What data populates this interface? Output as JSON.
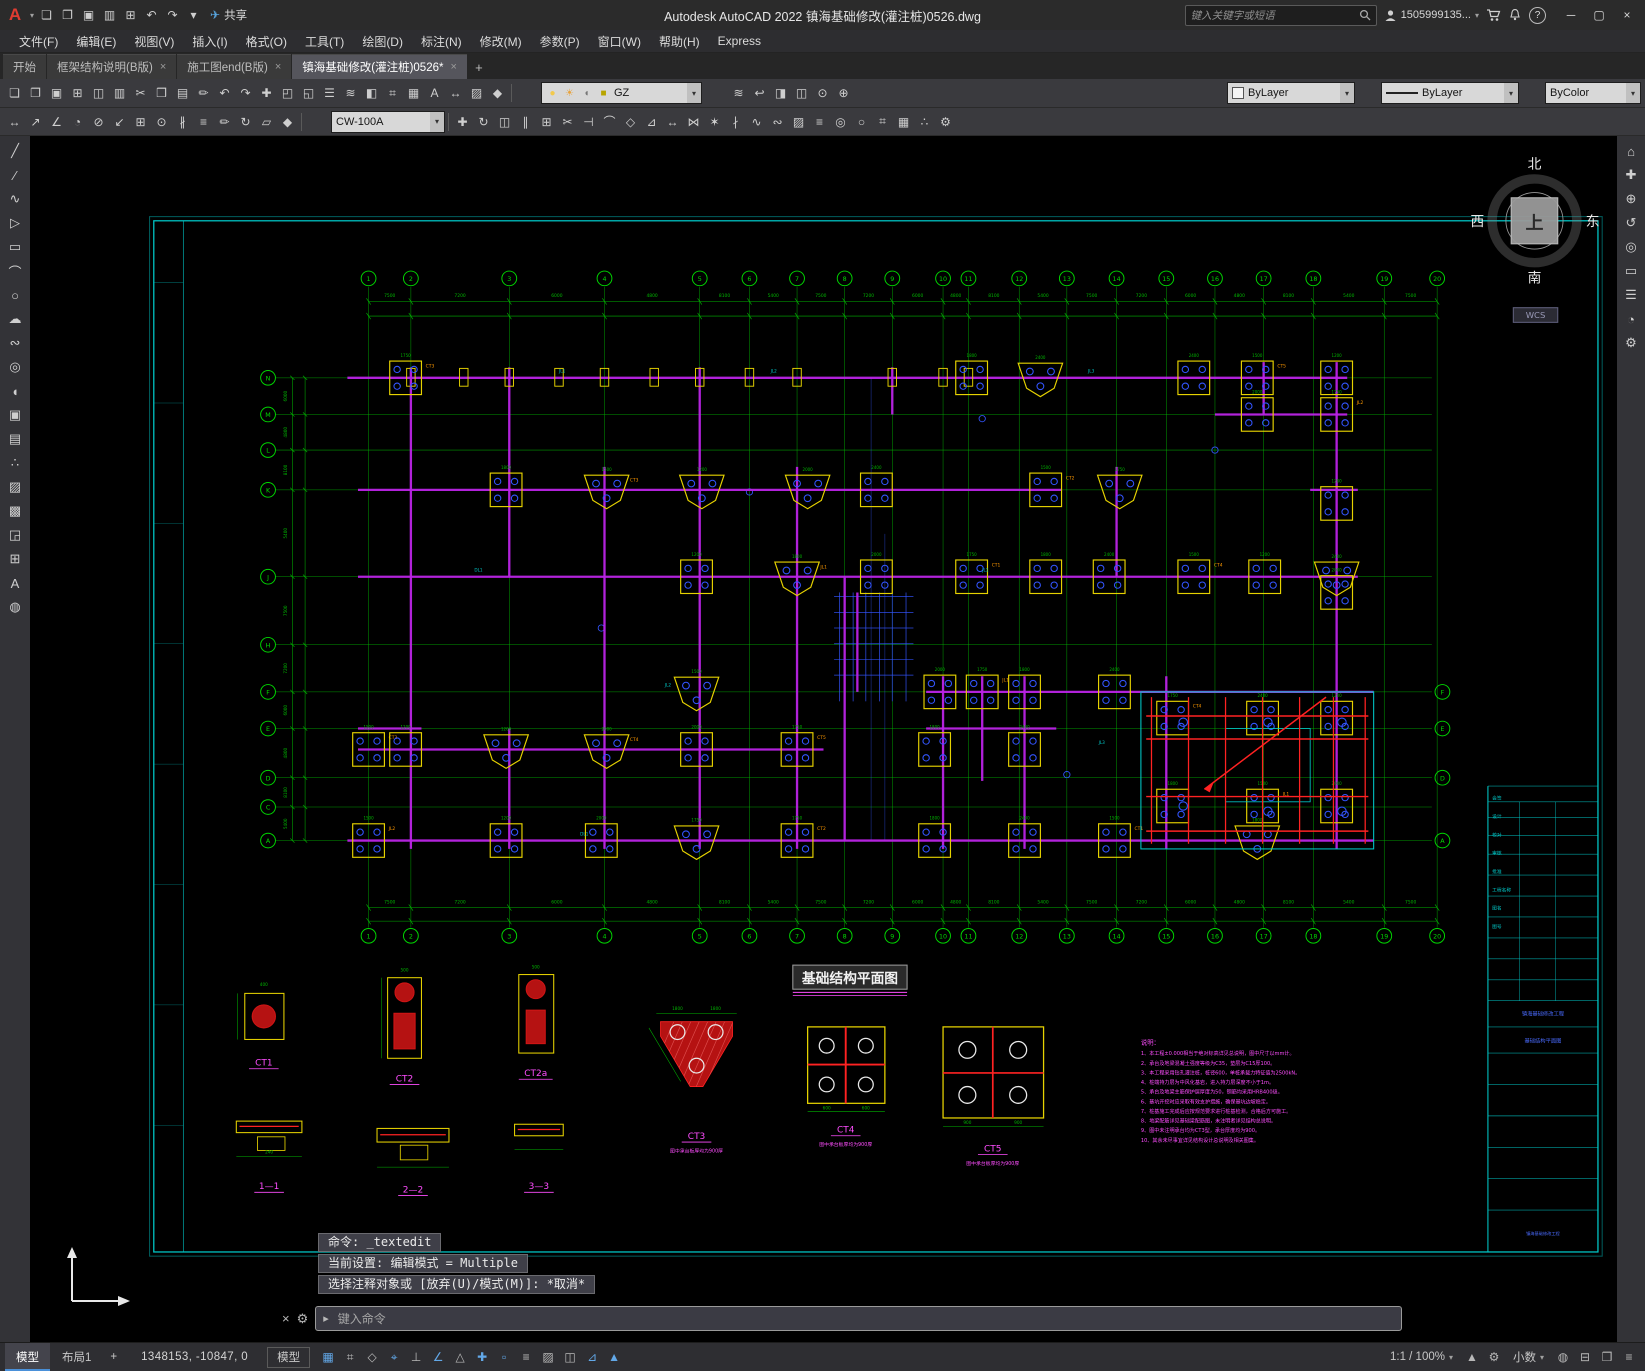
{
  "glyphs": {
    "caret": "▾",
    "close": "×"
  },
  "titlebar": {
    "logo": "A",
    "title": "Autodesk AutoCAD 2022   镇海基础修改(灌注桩)0526.dwg",
    "share_label": "共享",
    "share_icon": "✈",
    "search_placeholder": "键入关键字或短语",
    "account": "1505999135...",
    "help_glyph": "?",
    "qat_icons": [
      [
        "new-file",
        "❏"
      ],
      [
        "open-file",
        "❐"
      ],
      [
        "save",
        "▣"
      ],
      [
        "save-as",
        "▥"
      ],
      [
        "plot",
        "⊞"
      ],
      [
        "undo",
        "↶"
      ],
      [
        "redo",
        "↷"
      ],
      [
        "workspace-dropdown",
        "▾"
      ]
    ],
    "window_icons": [
      [
        "minimize",
        "─"
      ],
      [
        "maximize",
        "▢"
      ],
      [
        "close",
        "×"
      ]
    ]
  },
  "menubar": {
    "items": [
      "文件(F)",
      "编辑(E)",
      "视图(V)",
      "插入(I)",
      "格式(O)",
      "工具(T)",
      "绘图(D)",
      "标注(N)",
      "修改(M)",
      "参数(P)",
      "窗口(W)",
      "帮助(H)",
      "Express"
    ]
  },
  "tabs": {
    "items": [
      {
        "label": "开始",
        "closable": false,
        "active": false
      },
      {
        "label": "框架结构说明(B版)",
        "closable": true,
        "active": false
      },
      {
        "label": "施工图end(B版)",
        "closable": true,
        "active": false
      },
      {
        "label": "镇海基础修改(灌注桩)0526*",
        "closable": true,
        "active": true
      }
    ],
    "new_tab_glyph": "+"
  },
  "toolbar1": {
    "icons_a": [
      [
        "new",
        "❏"
      ],
      [
        "open",
        "❐"
      ],
      [
        "save",
        "▣"
      ],
      [
        "plot",
        "⊞"
      ],
      [
        "preview",
        "◫"
      ],
      [
        "publish",
        "▥"
      ],
      [
        "cut",
        "✂"
      ],
      [
        "copy",
        "❒"
      ],
      [
        "paste",
        "▤"
      ],
      [
        "match-properties",
        "✏"
      ],
      [
        "undo",
        "↶"
      ],
      [
        "redo",
        "↷"
      ],
      [
        "pan",
        "✚"
      ],
      [
        "zoom-window",
        "◰"
      ],
      [
        "zoom-extents",
        "◱"
      ],
      [
        "properties",
        "☰"
      ],
      [
        "layer-manager",
        "≋"
      ],
      [
        "blocks",
        "◧"
      ],
      [
        "measure",
        "⌗"
      ],
      [
        "table",
        "▦"
      ],
      [
        "text",
        "A"
      ],
      [
        "dimension",
        "↔"
      ],
      [
        "hatch",
        "▨"
      ],
      [
        "erase",
        "◆"
      ]
    ],
    "layer_icons": [
      [
        "layer-bulb",
        "●"
      ],
      [
        "layer-freeze-sun",
        "☀"
      ],
      [
        "layer-lock",
        "◖"
      ],
      [
        "layer-color-chip",
        "■"
      ]
    ],
    "layer_value": "GZ",
    "icons_b": [
      [
        "layer-states",
        "≋"
      ],
      [
        "layer-previous",
        "↩"
      ],
      [
        "layer-isolate",
        "◨"
      ],
      [
        "layer-unlock",
        "◫"
      ],
      [
        "make-current",
        "⊙"
      ],
      [
        "match-layer",
        "⊕"
      ]
    ],
    "color_value": "ByLayer",
    "linetype_value": "ByLayer",
    "plotstyle_value": "ByColor"
  },
  "toolbar2": {
    "icons_a": [
      [
        "dim-linear",
        "↔"
      ],
      [
        "dim-aligned",
        "↗"
      ],
      [
        "dim-angular",
        "∠"
      ],
      [
        "dim-radius",
        "◔"
      ],
      [
        "dim-diameter",
        "⊘"
      ],
      [
        "leader",
        "↙"
      ],
      [
        "tolerance",
        "⊞"
      ],
      [
        "center-mark",
        "⊙"
      ],
      [
        "dim-break",
        "∦"
      ],
      [
        "dim-space",
        "≡"
      ],
      [
        "dim-edit",
        "✏"
      ],
      [
        "dim-update",
        "↻"
      ],
      [
        "quick-dim",
        "▱"
      ],
      [
        "dim-style",
        "◆"
      ]
    ],
    "text_style_value": "CW-100A",
    "icons_b": [
      [
        "move",
        "✚"
      ],
      [
        "rotate",
        "↻"
      ],
      [
        "mirror",
        "◫"
      ],
      [
        "offset",
        "∥"
      ],
      [
        "array",
        "⊞"
      ],
      [
        "trim",
        "✂"
      ],
      [
        "extend",
        "⊣"
      ],
      [
        "fillet",
        "⌒"
      ],
      [
        "chamfer",
        "◇"
      ],
      [
        "scale",
        "⊿"
      ],
      [
        "stretch",
        "↔"
      ],
      [
        "join",
        "⋈"
      ],
      [
        "explode",
        "✶"
      ],
      [
        "break",
        "∤"
      ],
      [
        "edit-polyline",
        "∿"
      ],
      [
        "edit-spline",
        "∾"
      ],
      [
        "edit-hatch",
        "▨"
      ],
      [
        "align",
        "≡"
      ],
      [
        "group",
        "◎"
      ],
      [
        "ungroup",
        "○"
      ],
      [
        "measure-geometry",
        "⌗"
      ],
      [
        "quick-calc",
        "▦"
      ],
      [
        "point-style",
        "∴"
      ],
      [
        "draw-settings",
        "⚙"
      ]
    ]
  },
  "left_rail": {
    "icons": [
      [
        "line",
        "╱"
      ],
      [
        "construction-line",
        "∕"
      ],
      [
        "polyline",
        "∿"
      ],
      [
        "polygon",
        "▷"
      ],
      [
        "rectangle",
        "▭"
      ],
      [
        "arc",
        "⌒"
      ],
      [
        "circle",
        "○"
      ],
      [
        "revision-cloud",
        "☁"
      ],
      [
        "spline",
        "∾"
      ],
      [
        "ellipse",
        "◎"
      ],
      [
        "ellipse-arc",
        "◖"
      ],
      [
        "insert-block",
        "▣"
      ],
      [
        "create-block",
        "▤"
      ],
      [
        "point",
        "∴"
      ],
      [
        "hatch",
        "▨"
      ],
      [
        "gradient",
        "▩"
      ],
      [
        "region",
        "◲"
      ],
      [
        "table",
        "⊞"
      ],
      [
        "multiline-text",
        "A"
      ],
      [
        "color-palette",
        "◍"
      ]
    ]
  },
  "right_rail": {
    "icons": [
      [
        "viewcube-home",
        "⌂"
      ],
      [
        "pan",
        "✚"
      ],
      [
        "zoom",
        "⊕"
      ],
      [
        "orbit",
        "↺"
      ],
      [
        "steering-wheel",
        "◎"
      ],
      [
        "show-motion",
        "▭"
      ],
      [
        "nav-menu",
        "☰"
      ],
      [
        "zoom-extents",
        "◔"
      ],
      [
        "nav-settings",
        "⚙"
      ]
    ]
  },
  "viewport": {
    "compass": {
      "north": "北",
      "south": "南",
      "west": "西",
      "east": "东",
      "up": "上"
    },
    "wcs_label": "WCS",
    "drawing_title": "基础结构平面图",
    "grid_numbers": [
      "1",
      "2",
      "3",
      "4",
      "5",
      "6",
      "7",
      "8",
      "9",
      "10",
      "11",
      "12",
      "13",
      "14",
      "15",
      "16",
      "17",
      "18",
      "19",
      "20"
    ],
    "grid_letters": [
      "N",
      "M",
      "L",
      "K",
      "J",
      "H",
      "F",
      "E",
      "D",
      "C",
      "A"
    ],
    "dims": [
      "7500",
      "7200",
      "6000",
      "4800",
      "8100",
      "5400"
    ],
    "cap_dims": [
      "1750",
      "1800",
      "2400",
      "1500",
      "1200",
      "2000"
    ],
    "cap_tags": [
      "CT3",
      "CT4",
      "CT2",
      "CT5",
      "JL1",
      "CT1",
      "JL2"
    ],
    "beam_tags": [
      "JL1",
      "JL2",
      "JL3",
      "DL1"
    ],
    "details": {
      "ct1": "CT1",
      "ct2": "CT2",
      "ct2a": "CT2a",
      "ct3": "CT3",
      "ct4": "CT4",
      "ct5": "CT5",
      "s11": "1—1",
      "s22": "2—2",
      "s33": "3—3",
      "ct3_note": "图中承台板厚均为900厚",
      "ct4_note": "图中承台板厚均为900厚",
      "ct5_note": "图中承台板厚均为900厚"
    },
    "notes": [
      "说明：",
      "1、本工程±0.000相当于绝对标高详见总说明，图中尺寸以mm计。",
      "2、承台及地梁混凝土强度等级为C35，垫层为C15厚100。",
      "3、本工程采用钻孔灌注桩，桩径600，单桩承载力特征值为2500kN。",
      "4、桩端持力层为中风化基岩，进入持力层深度不小于1m。",
      "5、承台及地梁主筋保护层厚度为50，钢筋均采用HRB400级。",
      "6、基坑开挖时应采取有效支护措施，确保基坑边坡稳定。",
      "7、桩基施工完成后应按规范要求进行桩基检测，合格后方可施工。",
      "8、地梁配筋详见基础梁配筋图，未注明者详见结构总说明。",
      "9、图中未注明承台均为CT3型，承台厚度均为900。",
      "10、其余未尽事宜详见结构设计总说明及相关图集。"
    ],
    "titleblock": {
      "labels": [
        "会签",
        "设计",
        "校对",
        "审核",
        "批准",
        "工程名称",
        "图名",
        "图号"
      ],
      "project": "镇海基础修改工程",
      "sheet_title": "基础结构平面图"
    }
  },
  "command": {
    "history": [
      "命令: _textedit",
      "当前设置: 编辑模式 = Multiple",
      "选择注释对象或 [放弃(U)/模式(M)]: *取消*"
    ],
    "input_placeholder": "键入命令",
    "left_icons": [
      [
        "close-command",
        "×"
      ],
      [
        "command-settings",
        "⚙"
      ]
    ],
    "prompt_icon": "▸"
  },
  "statusbar": {
    "model_tab": "模型",
    "layout_tab": "布局1",
    "new_layout_glyph": "+",
    "coords": "1348153, -10847, 0",
    "model_button": "模型",
    "mid_icons": [
      [
        "grid-display",
        "▦",
        true
      ],
      [
        "snap-mode",
        "⌗",
        false
      ],
      [
        "infer-constraints",
        "◇",
        false
      ],
      [
        "dynamic-input",
        "⌖",
        true
      ],
      [
        "ortho-mode",
        "⊥",
        false
      ],
      [
        "polar-tracking",
        "∠",
        true
      ],
      [
        "isometric-drafting",
        "△",
        false
      ],
      [
        "object-snap-tracking",
        "✚",
        true
      ],
      [
        "object-snap",
        "▫",
        true
      ],
      [
        "lineweight",
        "≡",
        false
      ],
      [
        "transparency",
        "▨",
        false
      ],
      [
        "selection-cycling",
        "◫",
        false
      ],
      [
        "dynamic-ucs",
        "⊿",
        true
      ],
      [
        "annotation-visibility",
        "▲",
        true
      ]
    ],
    "scale": "1:1 / 100%",
    "units": "小数",
    "right_icons_a": [
      [
        "annotation-scale",
        "▲"
      ],
      [
        "workspace-switching",
        "⚙"
      ]
    ],
    "right_icons_b": [
      [
        "object-isolate",
        "◍"
      ],
      [
        "graphics-performance",
        "⊟"
      ],
      [
        "clean-screen",
        "❒"
      ],
      [
        "customize",
        "≡"
      ]
    ]
  }
}
